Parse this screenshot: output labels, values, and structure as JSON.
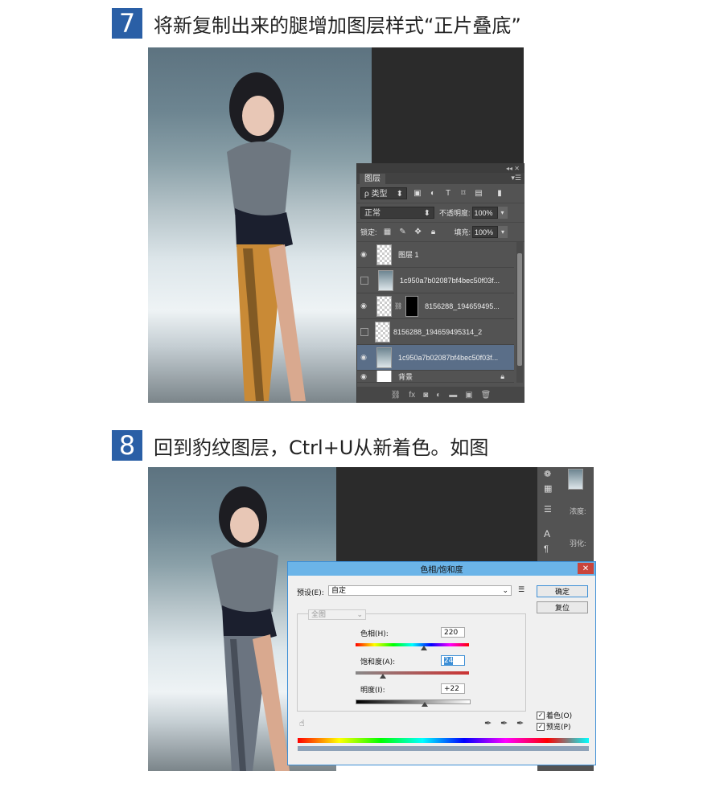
{
  "steps": [
    {
      "number": "7",
      "title": "将新复制出来的腿增加图层样式“正片叠底”"
    },
    {
      "number": "8",
      "title": "回到豹纹图层，Ctrl+U从新着色。如图"
    }
  ],
  "layers_panel": {
    "panel_icons": "◂◂ ✕",
    "tab": "图层",
    "menu_icon": "▾☰",
    "filter_label": "ρ 类型",
    "blend_mode": "正常",
    "opacity_label": "不透明度:",
    "opacity_value": "100%",
    "lock_label": "锁定:",
    "fill_label": "填充:",
    "fill_value": "100%",
    "layers": [
      {
        "name": "图层 1",
        "visible": true
      },
      {
        "name": "1c950a7b02087bf4bec50f03f...",
        "visible": false
      },
      {
        "name": "8156288_194659495...",
        "visible": true
      },
      {
        "name": "8156288_194659495314_2",
        "visible": false
      },
      {
        "name": "1c950a7b02087bf4bec50f03f...",
        "visible": true,
        "selected": true
      },
      {
        "name": "背景",
        "visible": true
      }
    ]
  },
  "right_panel": {
    "density_label": "浓度:",
    "feather_label": "羽化:"
  },
  "hue_dialog": {
    "title": "色相/饱和度",
    "close": "✕",
    "preset_label": "预设(E):",
    "preset_value": "自定",
    "ok": "确定",
    "reset": "复位",
    "channel": "全图",
    "hue_label": "色相(H):",
    "hue_value": "220",
    "saturation_label": "饱和度(A):",
    "saturation_value": "24",
    "lightness_label": "明度(I):",
    "lightness_value": "+22",
    "colorize_label": "着色(O)",
    "colorize_checked": true,
    "preview_label": "预览(P)",
    "preview_checked": true,
    "slider_positions": {
      "hue": 0.6,
      "saturation": 0.24,
      "lightness": 0.61
    }
  }
}
